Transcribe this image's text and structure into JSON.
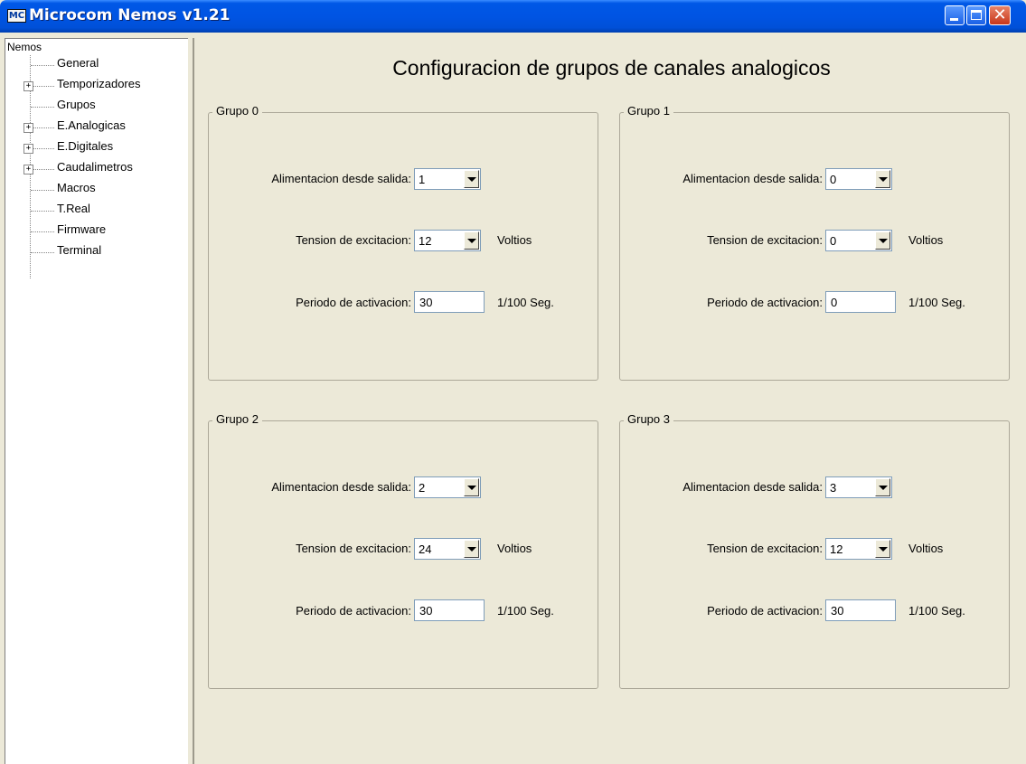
{
  "window": {
    "title": "Microcom Nemos v1.21",
    "app_icon_text": "MC"
  },
  "tree": {
    "root": "Nemos",
    "items": [
      {
        "label": "General",
        "expandable": false
      },
      {
        "label": "Temporizadores",
        "expandable": true
      },
      {
        "label": "Grupos",
        "expandable": false
      },
      {
        "label": "E.Analogicas",
        "expandable": true
      },
      {
        "label": "E.Digitales",
        "expandable": true
      },
      {
        "label": "Caudalimetros",
        "expandable": true
      },
      {
        "label": "Macros",
        "expandable": false
      },
      {
        "label": "T.Real",
        "expandable": false
      },
      {
        "label": "Firmware",
        "expandable": false
      },
      {
        "label": "Terminal",
        "expandable": false
      }
    ],
    "expand_glyph": "+"
  },
  "main": {
    "title": "Configuracion de grupos de canales analogicos",
    "labels": {
      "alimentacion": "Alimentacion desde salida:",
      "tension": "Tension de excitacion:",
      "periodo": "Periodo de activacion:",
      "voltios": "Voltios",
      "seg": "1/100 Seg."
    },
    "groups": [
      {
        "title": "Grupo  0",
        "alimentacion": "1",
        "tension": "12",
        "periodo": "30"
      },
      {
        "title": "Grupo  1",
        "alimentacion": "0",
        "tension": "0",
        "periodo": "0"
      },
      {
        "title": "Grupo  2",
        "alimentacion": "2",
        "tension": "24",
        "periodo": "30"
      },
      {
        "title": "Grupo  3",
        "alimentacion": "3",
        "tension": "12",
        "periodo": "30"
      }
    ]
  }
}
